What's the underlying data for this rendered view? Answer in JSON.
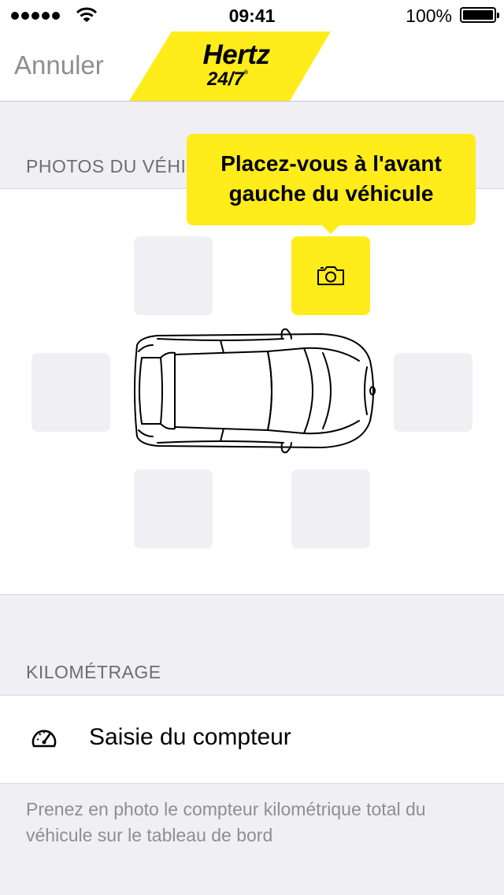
{
  "status_bar": {
    "time": "09:41",
    "battery": "100%"
  },
  "nav": {
    "cancel_label": "Annuler",
    "logo_main": "Hertz",
    "logo_sub": "24/7"
  },
  "photos_section": {
    "header": "PHOTOS DU VÉHICULE",
    "tooltip_line1": "Placez-vous à l'avant",
    "tooltip_line2": "gauche du véhicule"
  },
  "mileage_section": {
    "header": "KILOMÉTRAGE",
    "row_label": "Saisie du compteur",
    "footnote": "Prenez en photo le compteur kilométrique total du véhicule sur le tableau de bord"
  },
  "icons": [
    "wifi-icon",
    "battery-icon",
    "camera-icon",
    "car-top-view",
    "speedometer-icon"
  ],
  "colors": {
    "accent_yellow": "#ffec1a",
    "background": "#efeff4",
    "secondary_text": "#8e8e93"
  }
}
